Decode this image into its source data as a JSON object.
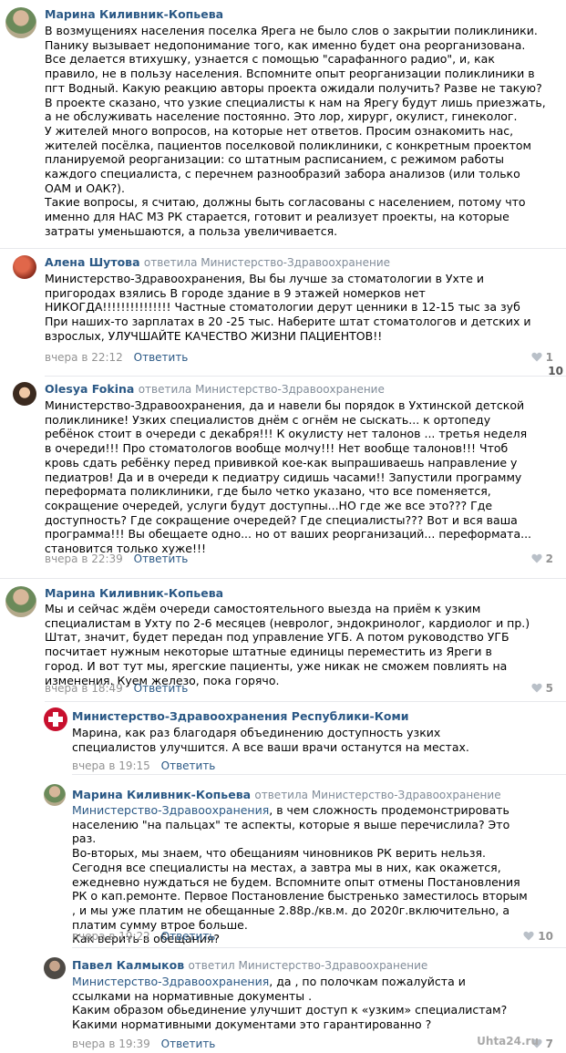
{
  "comments": [
    {
      "author": "Марина Киливник-Копьева",
      "replied": "",
      "addressee": "",
      "paragraphs": [
        "В возмущениях населения поселка Ярега не было слов о закрытии поликлиники. Панику вызывает недопонимание того, как именно будет она реорганизована. Все делается втихушку, узнается с помощью \"сарафанного радио\", и, как правило, не в пользу населения. Вспомните опыт реорганизации поликлиники в пгт Водный. Какую реакцию авторы проекта ожидали получить? Разве не такую?",
        "В проекте сказано, что узкие специалисты к нам на Ярегу будут лишь приезжать, а не обслуживать население постоянно. Это лор, хирург, окулист, гинеколог.",
        "У жителей много вопросов, на которые нет ответов. Просим ознакомить нас, жителей посёлка, пациентов поселковой поликлиники, с конкретным проектом планируемой реорганизации: со штатным расписанием, с режимом работы каждого специалиста, с перечнем разнообразий забора анализов (или только ОАМ и ОАК?).",
        "Такие вопросы, я считаю, должны быть согласованы с населением, потому что именно для НАС МЗ РК старается, готовит и реализует проекты, на которые затраты уменьшаются, а польза увеличивается."
      ],
      "time": "",
      "reply_label": "",
      "likes": ""
    },
    {
      "author": "Алена Шутова",
      "replied": "ответила Министерство-Здравоохранение",
      "addressee": "",
      "paragraphs": [
        "Министерство-Здравоохранения, Вы бы лучше за стоматологии в Ухте и пригородах взялись В городе здание в 9 этажей номерков нет НИКОГДА!!!!!!!!!!!!!!! Частные стоматологии дерут ценники в 12-15 тыс за зуб При наших-то зарплатах в 20 -25 тыс. Наберите штат стоматологов и детских и взрослых, УЛУЧШАЙТЕ КАЧЕСТВО ЖИЗНИ ПАЦИЕНТОВ!!"
      ],
      "time": "вчера в 22:12",
      "reply_label": "Ответить",
      "likes": "1"
    },
    {
      "author": "Olesya Fokina",
      "replied": "ответила Министерство-Здравоохранение",
      "addressee": "",
      "paragraphs": [
        "Министерство-Здравоохранения, да и навели бы порядок в Ухтинской детской поликлинике! Узких специалистов днём с огнём не сыскать... к ортопеду ребёнок стоит в очереди с декабря!!! К окулисту нет талонов ... третья неделя в очереди!!! Про стоматологов вообще молчу!!! Нет вообще талонов!!! Чтоб кровь сдать ребёнку перед прививкой кое-как выпрашиваешь направление у педиатров! Да и в очереди к педиатру сидишь часами!! Запустили программу переформата поликлиники, где было четко указано, что все поменяется, сокращение очередей, услуги будут доступны...НО где же все это??? Где доступность? Где сокращение очередей? Где специалисты??? Вот и вся ваша программа!!! Вы обещаете одно... но от ваших реорганизаций... переформата... становится только хуже!!!"
      ],
      "time": "вчера в 22:39",
      "reply_label": "Ответить",
      "likes": "2"
    },
    {
      "author": "Марина Киливник-Копьева",
      "replied": "",
      "addressee": "",
      "paragraphs": [
        "Мы и сейчас ждём очереди самостоятельного выезда на приём к узким специалистам в Ухту по 2-6 месяцев (невролог, эндокринолог, кардиолог и пр.) Штат, значит, будет передан под управление УГБ. А потом руководство УГБ посчитает нужным некоторые штатные единицы переместить из Яреги в город. И вот тут мы, ярегские пациенты, уже никак не сможем повлиять на изменения. Куем железо, пока горячо."
      ],
      "time": "вчера в 18:49",
      "reply_label": "Ответить",
      "likes": "5"
    },
    {
      "author": "Министерство-Здравоохранения Республики-Коми",
      "replied": "",
      "addressee": "",
      "paragraphs": [
        "Марина, как раз благодаря объединению доступность узких специалистов улучшится. А все ваши врачи останутся на местах."
      ],
      "time": "вчера в 19:15",
      "reply_label": "Ответить",
      "likes": ""
    },
    {
      "author": "Марина Киливник-Копьева",
      "replied": "ответила Министерство-Здравоохранение",
      "addressee": "Министерство-Здравоохранения",
      "paragraphs": [
        ", в чем сложность продемонстрировать населению \"на пальцах\" те аспекты, которые я выше перечислила? Это раз.",
        "Во-вторых, мы знаем, что обещаниям чиновников РК верить нельзя. Сегодня все специалисты на местах, а завтра мы в них, как окажется, ежедневно нуждаться не будем. Вспомните опыт отмены Постановления РК о кап.ремонте. Первое Постановление быстренько заместилось вторым , и мы уже платим не обещанные 2.88р./кв.м. до 2020г.включительно, а платим сумму втрое больше.",
        "Как верить в обещания?"
      ],
      "time": "вчера в 19:22",
      "reply_label": "Ответить",
      "likes": "10"
    },
    {
      "author": "Павел Калмыков",
      "replied": "ответил Министерство-Здравоохранение",
      "addressee": "Министерство-Здравоохранения",
      "paragraphs": [
        ", да , по полочкам пожалуйста и ссылками на нормативные документы .",
        "Каким образом обьединение улучшит доступ к «узким» специалистам?",
        "Какими нормативными документами это гарантированно ?"
      ],
      "time": "вчера в 19:39",
      "reply_label": "Ответить",
      "likes": "7"
    }
  ],
  "side_numbers": [
    "10"
  ],
  "watermark": "Uhta24.ru",
  "colors": {
    "link": "#2a5885",
    "meta": "#939393",
    "separator": "#e7e8ec"
  }
}
